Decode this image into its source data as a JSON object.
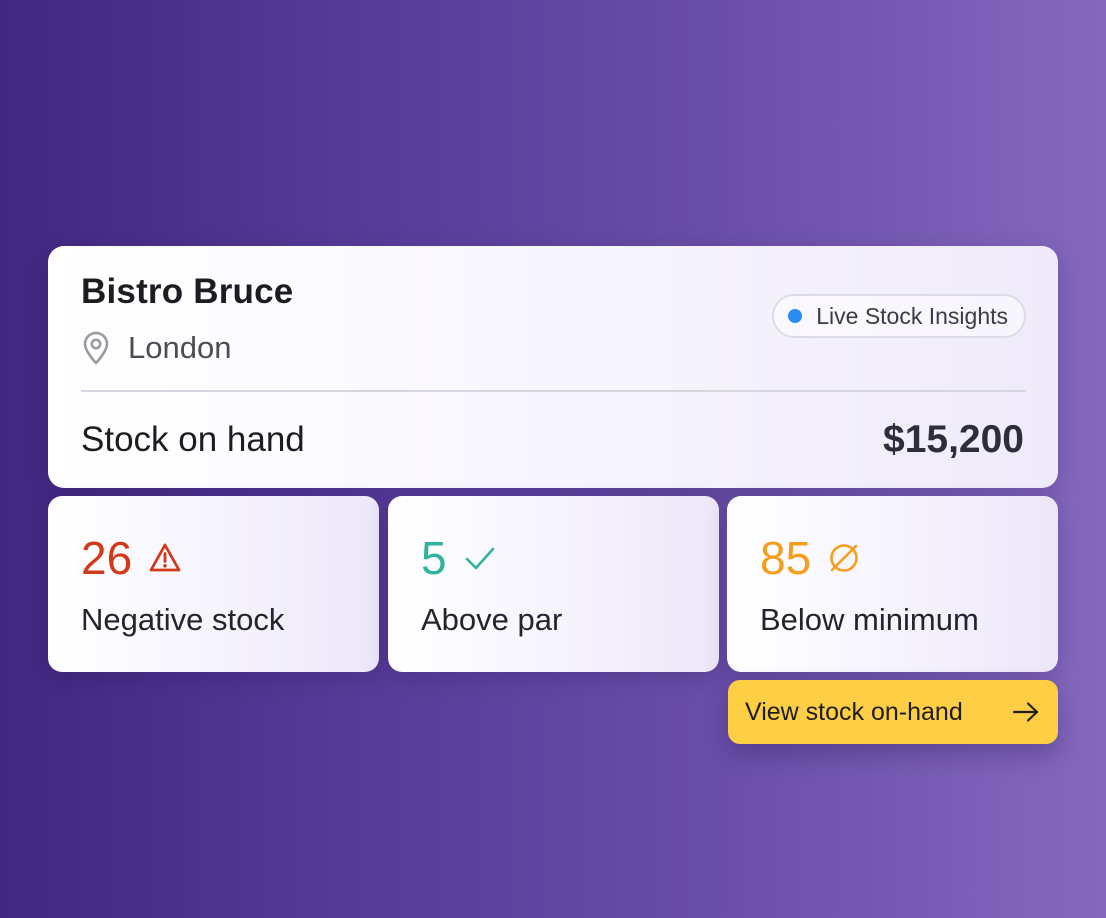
{
  "venue": {
    "name": "Bistro Bruce",
    "location": "London",
    "location_icon": "map-pin-icon"
  },
  "live_badge": {
    "label": "Live Stock Insights",
    "dot_color": "#2b8df2"
  },
  "summary": {
    "label": "Stock on hand",
    "value": "$15,200"
  },
  "stats": [
    {
      "value": "26",
      "label": "Negative stock",
      "icon": "warning-triangle-icon",
      "color": "#d2391b"
    },
    {
      "value": "5",
      "label": "Above par",
      "icon": "checkmark-icon",
      "color": "#2fb39c"
    },
    {
      "value": "85",
      "label": "Below minimum",
      "icon": "empty-set-icon",
      "color": "#f59e1e"
    }
  ],
  "cta": {
    "label": "View stock on-hand",
    "icon": "arrow-right-icon",
    "color": "#fece45"
  }
}
